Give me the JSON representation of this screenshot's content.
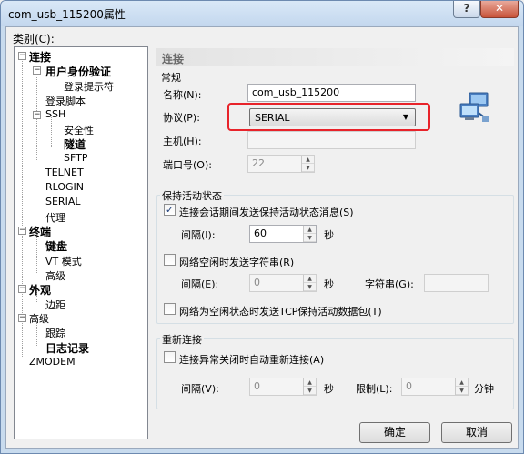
{
  "window": {
    "title": "com_usb_115200属性",
    "help_label": "?",
    "close_label": "✕"
  },
  "category_label": "类别(C):",
  "tree": {
    "connection": "连接",
    "auth": "用户身份验证",
    "login_prompt": "登录提示符",
    "login_script": "登录脚本",
    "ssh": "SSH",
    "security": "安全性",
    "tunnel": "隧道",
    "sftp": "SFTP",
    "telnet": "TELNET",
    "rlogin": "RLOGIN",
    "serial": "SERIAL",
    "proxy": "代理",
    "terminal": "终端",
    "keyboard": "键盘",
    "vt_mode": "VT 模式",
    "advanced_term": "高级",
    "appearance": "外观",
    "margin": "边距",
    "advanced": "高级",
    "trace": "跟踪",
    "logging": "日志记录",
    "zmodem": "ZMODEM",
    "expand_minus": "−"
  },
  "panel": {
    "header": "连接",
    "general_title": "常规",
    "name_label": "名称(N):",
    "name_value": "com_usb_115200",
    "protocol_label": "协议(P):",
    "protocol_value": "SERIAL",
    "host_label": "主机(H):",
    "host_value": "",
    "port_label": "端口号(O):",
    "port_value": "22",
    "keepalive_title": "保持活动状态",
    "keepalive_check_label": "连接会话期间发送保持活动状态消息(S)",
    "keepalive_checked": true,
    "interval_label": "间隔(I):",
    "interval_value": "60",
    "seconds": "秒",
    "idle_string_label": "网络空闲时发送字符串(R)",
    "idle_interval_label": "间隔(E):",
    "idle_interval_value": "0",
    "idle_seconds": "秒",
    "string_label": "字符串(G):",
    "string_value": "",
    "tcp_keepalive_label": "网络为空闲状态时发送TCP保持活动数据包(T)",
    "reconnect_title": "重新连接",
    "reconnect_label": "连接异常关闭时自动重新连接(A)",
    "reconnect_interval_label": "间隔(V):",
    "reconnect_interval_value": "0",
    "reconnect_seconds": "秒",
    "limit_label": "限制(L):",
    "limit_value": "0",
    "minutes": "分钟"
  },
  "buttons": {
    "ok": "确定",
    "cancel": "取消"
  },
  "colors": {
    "highlight": "#e8232a"
  }
}
